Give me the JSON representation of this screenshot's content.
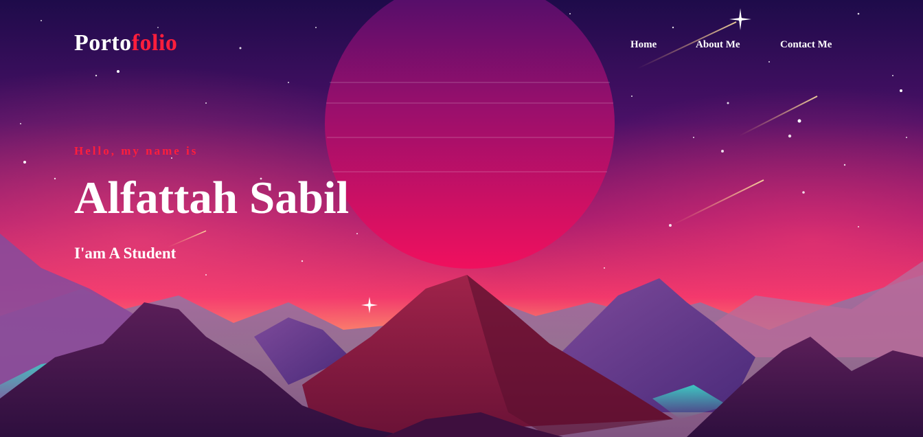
{
  "brand": {
    "text_main": "Porto",
    "text_accent": "folio"
  },
  "nav": {
    "items": [
      {
        "label": "Home"
      },
      {
        "label": "About Me"
      },
      {
        "label": "Contact Me"
      }
    ]
  },
  "hero": {
    "greeting": "Hello, my name is",
    "name": "Alfattah Sabil",
    "role": "I'am A Student"
  },
  "colors": {
    "accent": "#ff1e3c",
    "text": "#ffffff",
    "sky_top": "#2a0d4f",
    "sky_glow": "#e8245e",
    "moon": "#d8185e"
  }
}
